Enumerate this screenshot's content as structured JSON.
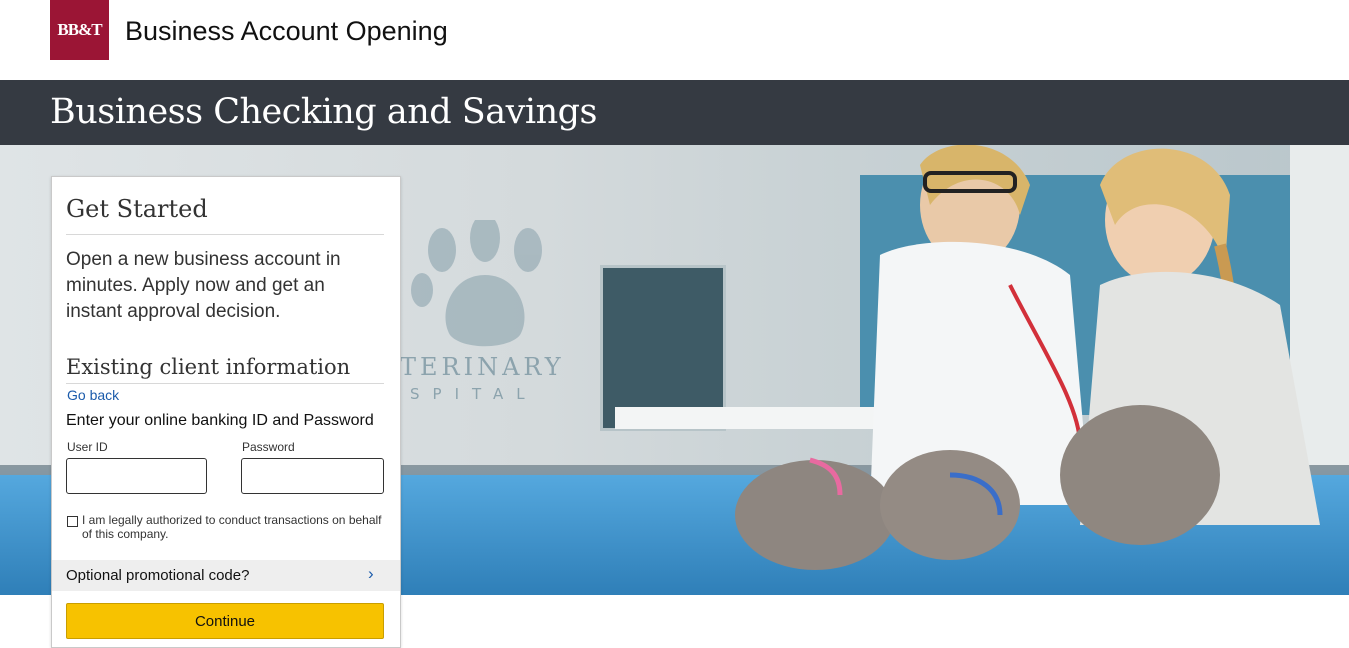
{
  "header": {
    "logo_text": "BB&T",
    "app_title": "Business Account Opening"
  },
  "banner": {
    "title": "Business Checking and Savings"
  },
  "hero": {
    "signage_line1": "TERINARY",
    "signage_line2": "SPITAL"
  },
  "card": {
    "title": "Get Started",
    "description": "Open a new business account in minutes. Apply now and get an instant approval decision.",
    "section_title": "Existing client information",
    "go_back": "Go back",
    "instructions": "Enter your online banking ID and Password",
    "user_id_label": "User ID",
    "password_label": "Password",
    "user_id_value": "",
    "password_value": "",
    "authorization_text": "I am legally authorized to conduct transactions on behalf of this company.",
    "authorization_checked": false,
    "promo_label": "Optional promotional code?",
    "promo_icon": "chevron-right-icon",
    "continue_label": "Continue"
  },
  "colors": {
    "brand": "#9b1535",
    "banner": "#353a42",
    "link": "#1b5bab",
    "button": "#f7c200"
  }
}
